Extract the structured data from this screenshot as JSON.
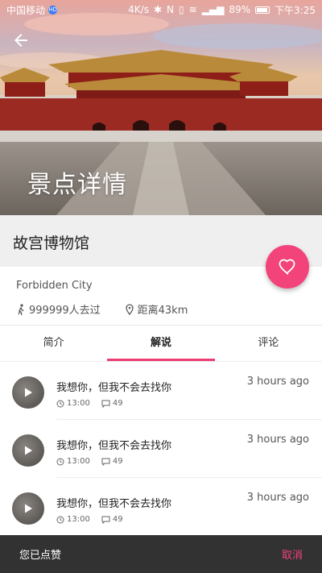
{
  "status_bar": {
    "carrier": "中国移动",
    "hd_badge": "HD",
    "speed": "4K/s",
    "battery": "89%",
    "time": "下午3:25"
  },
  "header": {
    "back_icon": "arrow-left-icon",
    "title": "景点详情"
  },
  "place": {
    "name": "故宫博物馆",
    "english_name": "Forbidden City",
    "visitors": "999999人去过",
    "distance": "距离43km"
  },
  "tabs": [
    {
      "label": "简介",
      "active": false
    },
    {
      "label": "解说",
      "active": true
    },
    {
      "label": "评论",
      "active": false
    }
  ],
  "list": [
    {
      "title": "我想你，但我不会去找你",
      "time": "3 hours ago",
      "duration": "13:00",
      "comments": "49"
    },
    {
      "title": "我想你，但我不会去找你",
      "time": "3 hours ago",
      "duration": "13:00",
      "comments": "49"
    },
    {
      "title": "我想你，但我不会去找你",
      "time": "3 hours ago",
      "duration": "13:00",
      "comments": "49"
    }
  ],
  "snackbar": {
    "message": "您已点赞",
    "action": "取消"
  },
  "colors": {
    "accent": "#f2437a",
    "tab_indicator": "#ee3d72",
    "snackbar_bg": "#323232"
  }
}
